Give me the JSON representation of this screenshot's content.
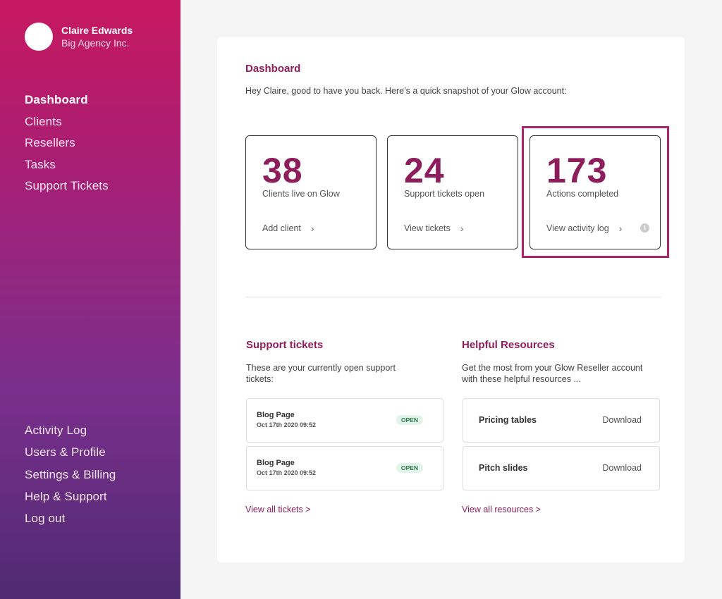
{
  "user": {
    "name": "Claire Edwards",
    "company": "Big Agency Inc."
  },
  "nav_top": [
    "Dashboard",
    "Clients",
    "Resellers",
    "Tasks",
    "Support Tickets"
  ],
  "nav_bottom": [
    "Activity Log",
    "Users & Profile",
    "Settings & Billing",
    "Help & Support",
    "Log out"
  ],
  "page": {
    "title": "Dashboard",
    "intro": "Hey Claire, good to have you back. Here’s a quick snapshot of your Glow account:"
  },
  "stats": [
    {
      "value": "38",
      "label": "Clients live on Glow",
      "link": "Add client"
    },
    {
      "value": "24",
      "label": "Support tickets open",
      "link": "View tickets"
    },
    {
      "value": "173",
      "label": "Actions completed",
      "link": "View activity log"
    }
  ],
  "support": {
    "title": "Support tickets",
    "description": "These are your currently open support tickets:",
    "tickets": [
      {
        "title": "Blog Page",
        "date": "Oct 17th 2020 09:52",
        "status": "OPEN"
      },
      {
        "title": "Blog Page",
        "date": "Oct 17th 2020 09:52",
        "status": "OPEN"
      }
    ],
    "view_all": "View all tickets >"
  },
  "resources": {
    "title": "Helpful Resources",
    "description": "Get the most from your Glow Reseller account with these helpful resources ...",
    "items": [
      {
        "name": "Pricing tables",
        "action": "Download"
      },
      {
        "name": "Pitch slides",
        "action": "Download"
      }
    ],
    "view_all": "View all resources >"
  },
  "icons": {
    "chevron": "chevron-right-icon",
    "info": "info-icon"
  },
  "colors": {
    "accent": "#8e1d5c",
    "highlight": "#b0226a",
    "badge_bg": "#e2f4ea",
    "badge_text": "#2a7a4a"
  }
}
